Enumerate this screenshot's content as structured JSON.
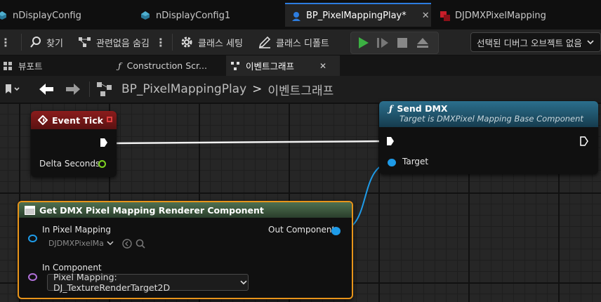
{
  "tabs": [
    {
      "label": "nDisplayConfig",
      "active": false
    },
    {
      "label": "nDisplayConfig1",
      "active": false
    },
    {
      "label": "BP_PixelMappingPlay*",
      "active": true
    },
    {
      "label": "DJDMXPixelMapping",
      "active": false
    }
  ],
  "toolbar": {
    "find_label": "찾기",
    "hide_unrelated_label": "관련없음 숨김",
    "class_settings_label": "클래스 세팅",
    "class_defaults_label": "클래스 디폴트",
    "debug_object_label": "선택된 디버그 오브젝트 없음"
  },
  "subtabs": [
    {
      "label": "뷰포트"
    },
    {
      "label": "Construction Scr..."
    },
    {
      "label": "이벤트그래프",
      "active": true
    }
  ],
  "breadcrumb": {
    "blueprint": "BP_PixelMappingPlay",
    "separator": ">",
    "graph": "이벤트그래프"
  },
  "nodes": {
    "event_tick": {
      "title": "Event Tick",
      "delta_label": "Delta Seconds"
    },
    "send_dmx": {
      "title": "Send DMX",
      "subtitle": "Target is DMXPixel Mapping Base Component",
      "target_label": "Target"
    },
    "get_renderer": {
      "title": "Get DMX Pixel Mapping Renderer Component",
      "in_pixel_mapping_label": "In Pixel Mapping",
      "in_pixel_mapping_value": "DJDMXPixelMa",
      "in_component_label": "In Component",
      "in_component_value": "Pixel Mapping: DJ_TextureRenderTarget2D",
      "out_component_label": "Out Component"
    }
  },
  "colors": {
    "accent": "#2d7de0",
    "event_header": "#7a1a1a",
    "function_header": "#1f5f7a",
    "pure_header": "#4a6e4a",
    "selection": "#e8941a",
    "object_pin": "#1e9be8",
    "float_pin": "#7ed321",
    "struct_pin": "#b070d8",
    "play_green": "#3cb043"
  }
}
